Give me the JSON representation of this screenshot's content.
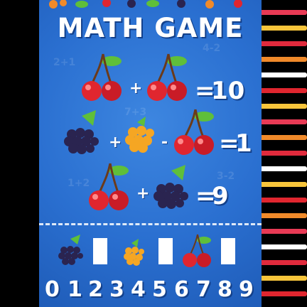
{
  "title": "MATH GAME",
  "equations": [
    {
      "terms": [
        "cherry",
        "cherry"
      ],
      "operators": [
        "+"
      ],
      "result": "10"
    },
    {
      "terms": [
        "blackberry",
        "cloudberry",
        "cherry"
      ],
      "operators": [
        "+",
        "-"
      ],
      "result": "1"
    },
    {
      "terms": [
        "cherry",
        "blackberry"
      ],
      "operators": [
        "+"
      ],
      "result": "9"
    }
  ],
  "answer_row": [
    "blackberry",
    "cloudberry",
    "cherry"
  ],
  "digits": [
    "0",
    "1",
    "2",
    "3",
    "4",
    "5",
    "6",
    "7",
    "8",
    "9"
  ],
  "colors": {
    "board": "#2a6fd0",
    "cherry": "#e0262f",
    "blackberry": "#2a2450",
    "cloudberry": "#f5a623",
    "leaf": "#5fbf3a"
  }
}
